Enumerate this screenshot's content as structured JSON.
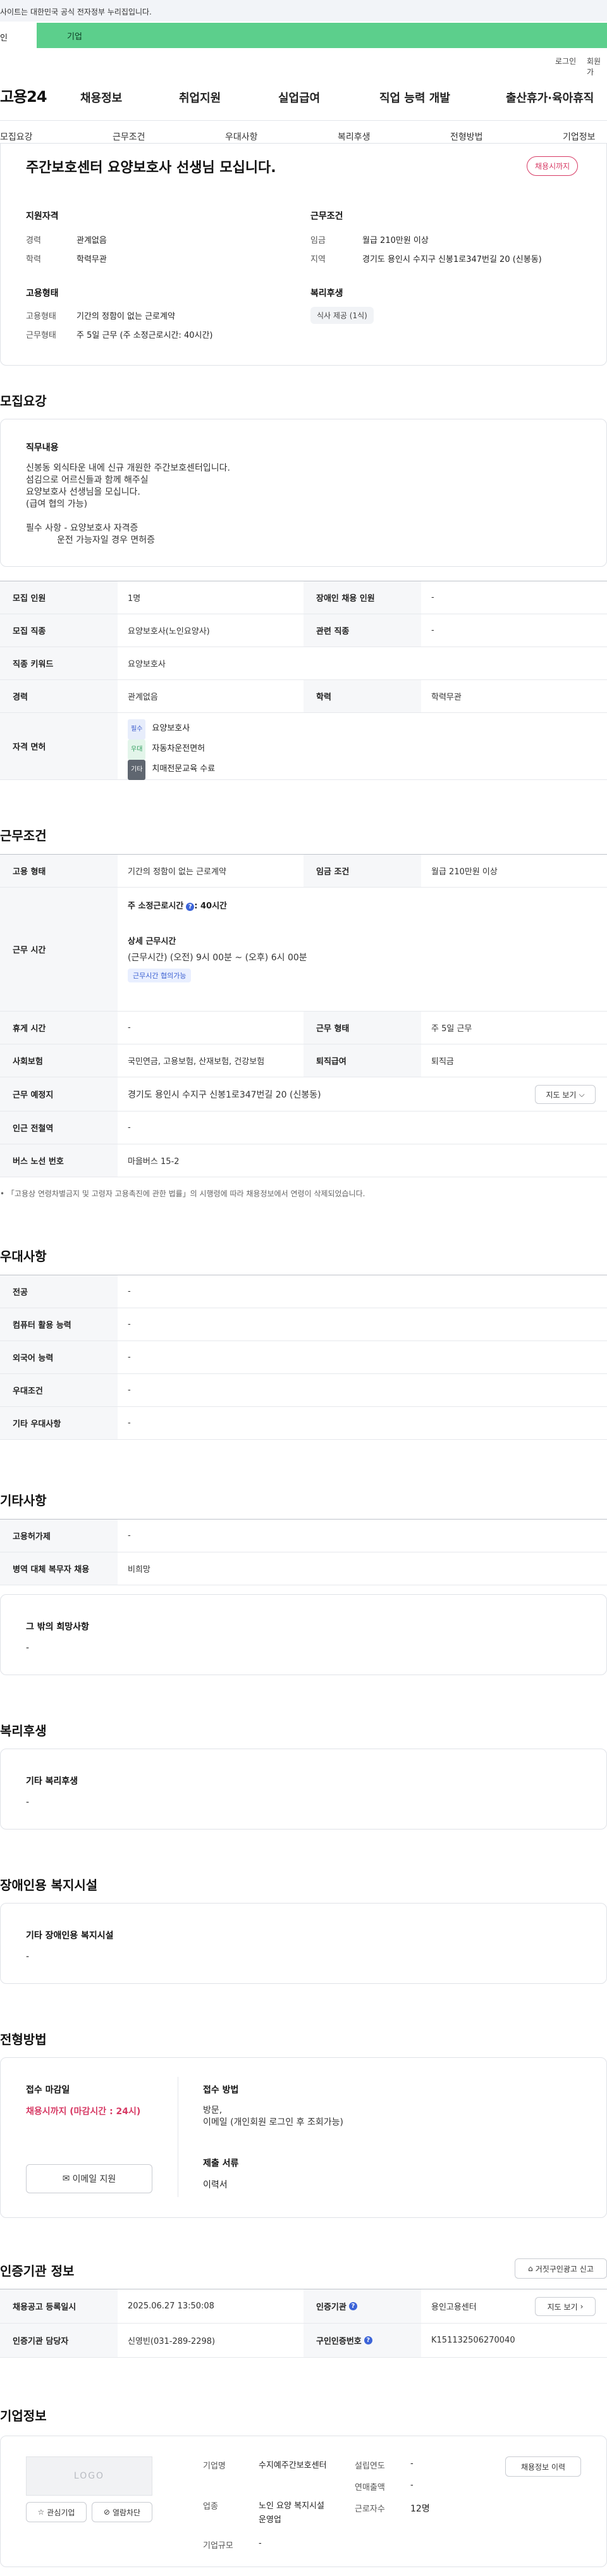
{
  "gov_bar": "사이트는 대한민국 공식 전자정부 누리집입니다.",
  "tabs": [
    "인",
    "기업"
  ],
  "util_links": [
    "로그인",
    "회원가"
  ],
  "logo": "고용24",
  "gnb": [
    "채용정보",
    "취업지원",
    "실업급여",
    "직업 능력 개발",
    "출산휴가·육아휴직"
  ],
  "snb": [
    "모집요강",
    "근무조건",
    "우대사항",
    "복리후생",
    "전형방법",
    "기업정보"
  ],
  "summary": {
    "title": "주간보호센터 요양보호사 선생님 모십니다.",
    "badge": "채용시까지",
    "qual_title": "지원자격",
    "qual": [
      {
        "label": "경력",
        "value": "관계없음"
      },
      {
        "label": "학력",
        "value": "학력무관"
      }
    ],
    "cond_title": "근무조건",
    "cond": [
      {
        "label": "임금",
        "value": "월급 210만원 이상"
      },
      {
        "label": "지역",
        "value": "경기도 용인시 수지구 신봉1로347번길 20 (신봉동)"
      }
    ],
    "emp_title": "고용형태",
    "emp": [
      {
        "label": "고용형태",
        "value": "기간의 정함이 없는 근로계약"
      },
      {
        "label": "근무형태",
        "value": "주 5일 근무 (주 소정근로시간: 40시간)"
      }
    ],
    "welfare_title": "복리후생",
    "welfare_chip": "식사 제공 (1식)"
  },
  "recruit": {
    "title": "모집요강",
    "duty_title": "직무내용",
    "duty_text": "신봉동 외식타운 내에 신규 개원한 주간보호센터입니다.\n섬김으로 어르신들과 함께 해주실\n요양보호사 선생님을 모십니다.\n(급여 협의 가능)\n\n필수 사항 - 요양보호사 자격증\n           운전 가능자일 경우 면허증",
    "rows": [
      {
        "th": "모집 인원",
        "td": "1명",
        "th2": "장애인 채용 인원",
        "td2": "-"
      },
      {
        "th": "모집 직종",
        "td": "요양보호사(노인요양사)",
        "th2": "관련 직종",
        "td2": "-"
      },
      {
        "th": "직종 키워드",
        "td": "요양보호사"
      },
      {
        "th": "경력",
        "td": "관계없음",
        "th2": "학력",
        "td2": "학력무관"
      }
    ],
    "license_th": "자격 면허",
    "licenses": [
      {
        "tag": "필수",
        "name": "요양보호사"
      },
      {
        "tag": "우대",
        "name": "자동차운전면허"
      },
      {
        "tag": "기타",
        "name": "치매전문교육 수료"
      }
    ]
  },
  "work": {
    "title": "근무조건",
    "row1": {
      "th": "고용 형태",
      "td": "기간의 정함이 없는 근로계약",
      "th2": "임금 조건",
      "td2": "월급 210만원 이상"
    },
    "time_th": "근무 시간",
    "weekly_label": "주 소정근로시간",
    "weekly_value": ": 40시간",
    "detail_label": "상세 근무시간",
    "detail_value": "(근무시간) (오전) 9시 00분 ~ (오후) 6시 00분",
    "time_chip": "근무시간 협의가능",
    "rows": [
      {
        "th": "휴게 시간",
        "td": "-",
        "th2": "근무 형태",
        "td2": "주 5일 근무"
      },
      {
        "th": "사회보험",
        "td": "국민연금, 고용보험, 산재보험, 건강보험",
        "th2": "퇴직급여",
        "td2": "퇴직금"
      }
    ],
    "place_th": "근무 예정지",
    "place_td": "경기도 용인시 수지구 신봉1로347번길 20 (신봉동)",
    "map_btn": "지도 보기",
    "rows2": [
      {
        "th": "인근 전철역",
        "td": "-"
      },
      {
        "th": "버스 노선 번호",
        "td": "마을버스 15-2"
      }
    ],
    "note": "「고용상 연령차별금지 및 고령자 고용촉진에 관한 법률」의 시행령에 따라 채용정보에서 연령이 삭제되었습니다."
  },
  "pref": {
    "title": "우대사항",
    "rows": [
      {
        "th": "전공",
        "td": "-"
      },
      {
        "th": "컴퓨터 활용 능력",
        "td": "-"
      },
      {
        "th": "외국어 능력",
        "td": "-"
      },
      {
        "th": "우대조건",
        "td": "-"
      },
      {
        "th": "기타 우대사항",
        "td": "-"
      }
    ]
  },
  "etc": {
    "title": "기타사항",
    "rows": [
      {
        "th": "고용허가제",
        "td": "-"
      },
      {
        "th": "병역 대체 복무자 채용",
        "td": "비희망"
      }
    ],
    "hope_title": "그 밖의 희망사항",
    "hope_value": "-"
  },
  "welfare": {
    "title": "복리후생",
    "sub": "기타 복리후생",
    "value": "-"
  },
  "facility": {
    "title": "장애인용 복지시설",
    "sub": "기타 장애인용 복지시설",
    "value": "-"
  },
  "selection": {
    "title": "전형방법",
    "deadline_label": "접수 마감일",
    "deadline_value": "채용시까지 (마감시간 : 24시)",
    "email_btn": "이메일 지원",
    "method_label": "접수 방법",
    "method_value": "방문,\n이메일 (개인회원 로그인 후 조회가능)",
    "docs_label": "제출 서류",
    "docs_value": "이력서"
  },
  "cert": {
    "title": "인증기관 정보",
    "report_btn": "거짓구인광고 신고",
    "row1": {
      "th": "채용공고 등록일시",
      "td": "2025.06.27 13:50:08",
      "th2": "인증기관",
      "td2": "용인고용센터"
    },
    "map_btn": "지도 보기",
    "row2": {
      "th": "인증기관 담당자",
      "td": "신영빈(031-289-2298)",
      "th2": "구인인증번호",
      "td2": "K151132506270040"
    }
  },
  "company": {
    "title": "기업정보",
    "logo_text": "LOGO",
    "fav_btn": "관심기업",
    "block_btn": "열람차단",
    "history_btn": "채용정보 이력",
    "fields": [
      {
        "label": "기업명",
        "value": "수지예주간보호센터"
      },
      {
        "label": "업종",
        "value": "노인 요양 복지시설 운영업"
      },
      {
        "label": "기업규모",
        "value": "-"
      },
      {
        "label": "설립연도",
        "value": "-"
      },
      {
        "label": "연매출액",
        "value": "-"
      },
      {
        "label": "근로자수",
        "value": "12명"
      }
    ]
  },
  "colors": {
    "accent_green": "#5ccf8c",
    "badge_red": "#d73a64",
    "info_blue": "#3c64d8"
  }
}
